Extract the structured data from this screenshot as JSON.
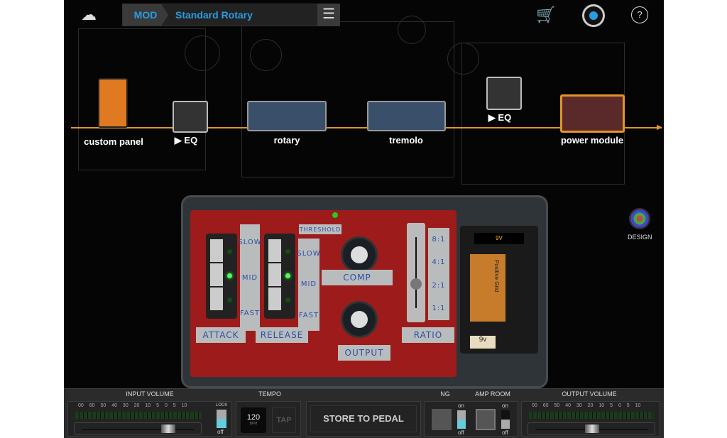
{
  "header": {
    "mod_label": "MOD",
    "preset_name": "Standard Rotary",
    "icons": [
      "cloud-icon",
      "dropdown-icon",
      "menu-icon",
      "cart-icon",
      "gear-icon",
      "help-icon"
    ],
    "help_label": "?"
  },
  "chain": [
    {
      "label": "custom panel"
    },
    {
      "label": "▶ EQ"
    },
    {
      "label": "rotary"
    },
    {
      "label": "tremolo"
    },
    {
      "label": "▶ EQ"
    },
    {
      "label": "power module"
    }
  ],
  "design_label": "DESIGN",
  "pedal": {
    "threshold": "THRESHOLD",
    "attack": {
      "label": "ATTACK",
      "options": [
        "SLOW",
        "MID",
        "FAST"
      ],
      "selected": "MID"
    },
    "release": {
      "label": "RELEASE",
      "options": [
        "SLOW",
        "MID",
        "FAST"
      ],
      "selected": "MID"
    },
    "comp_label": "COMP",
    "output_label": "OUTPUT",
    "ratio": {
      "label": "RATIO",
      "options": [
        "8:1",
        "4:1",
        "2:1",
        "1:1"
      ]
    },
    "battery_label": "9V",
    "battery_brand": "Positive Grid",
    "battery_tag": "9v"
  },
  "bottom": {
    "input_volume": {
      "label": "INPUT VOLUME",
      "scale": "00 60 50 40 30 20 10 5 0 5 10",
      "lock": "LOCK",
      "lock_state": "off"
    },
    "tempo": {
      "label": "TEMPO",
      "bpm": "120",
      "bpm_unit": "BPM",
      "tap": "TAP"
    },
    "store": "STORE TO PEDAL",
    "ng": {
      "label": "NG",
      "on": "on",
      "off": "off"
    },
    "amp_room": {
      "label": "AMP ROOM",
      "on": "on",
      "off": "off"
    },
    "output_volume": {
      "label": "OUTPUT VOLUME",
      "scale": "00 60 50 40 30 20 10 5 0 5 10"
    }
  },
  "colors": {
    "accent": "#2a9ce0",
    "chain": "#e0952c",
    "pcb": "#9e1b1b"
  }
}
